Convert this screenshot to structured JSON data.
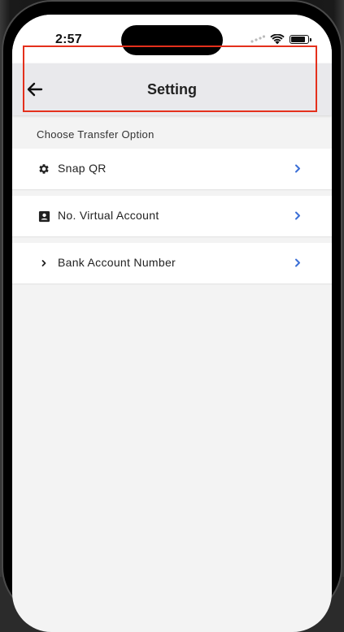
{
  "status_bar": {
    "time": "2:57",
    "icons": [
      "cellular-icon",
      "wifi-icon",
      "battery-icon"
    ]
  },
  "header": {
    "title": "Setting",
    "back_icon": "arrow-left-icon"
  },
  "section": {
    "label": "Choose Transfer Option"
  },
  "options": [
    {
      "label": "Snap QR",
      "icon": "gear-icon",
      "trailing_icon": "chevron-right-icon"
    },
    {
      "label": "No. Virtual Account",
      "icon": "contact-card-icon",
      "trailing_icon": "chevron-right-icon"
    },
    {
      "label": "Bank Account Number",
      "icon": "chevron-right-small-icon",
      "trailing_icon": "chevron-right-icon"
    }
  ],
  "colors": {
    "accent": "#3b6fd6",
    "highlight": "#e4301c",
    "header_bg": "#e9e9ec",
    "screen_bg": "#f3f3f3"
  }
}
